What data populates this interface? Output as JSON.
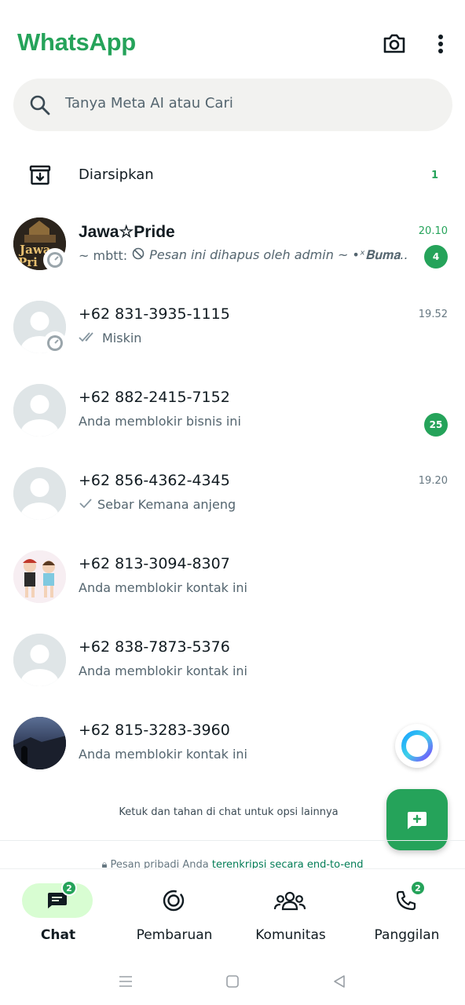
{
  "header": {
    "title": "WhatsApp",
    "camera_icon": "camera-icon",
    "menu_icon": "more-vertical-icon"
  },
  "search": {
    "placeholder": "Tanya Meta AI atau Cari",
    "icon": "search-icon"
  },
  "archived": {
    "label": "Diarsipkan",
    "count": "1",
    "icon": "archive-icon"
  },
  "chats": [
    {
      "name": "Jawa☆Pride",
      "sender": "~ mbtt:",
      "preview": "Pesan ini dihapus oleh admin ~ •ˣ𝐁𝐮𝐦𝐚...",
      "time": "20.10",
      "unread": "4",
      "avatar": "group-photo",
      "status_ring": true
    },
    {
      "name": "+62 831-3935-1115",
      "preview": "Miskin",
      "time": "19.52",
      "unread": "",
      "avatar": "default",
      "status_ring": true,
      "ticks": "double"
    },
    {
      "name": "+62 882-2415-7152",
      "preview": "Anda memblokir bisnis ini",
      "time": "",
      "unread": "25",
      "avatar": "default"
    },
    {
      "name": "+62 856-4362-4345",
      "preview": "Sebar Kemana anjeng",
      "time": "19.20",
      "unread": "",
      "avatar": "default",
      "ticks": "single"
    },
    {
      "name": "+62 813-3094-8307",
      "preview": "Anda memblokir kontak ini",
      "time": "",
      "unread": "",
      "avatar": "cartoon-photo"
    },
    {
      "name": "+62 838-7873-5376",
      "preview": "Anda memblokir kontak ini",
      "time": "",
      "unread": "",
      "avatar": "default"
    },
    {
      "name": "+62 815-3283-3960",
      "preview": "Anda memblokir kontak ini",
      "time": "",
      "unread": "",
      "avatar": "night-photo"
    }
  ],
  "hint": "Ketuk dan tahan di chat untuk opsi lainnya",
  "e2e": {
    "prefix": "Pesan pribadi Anda",
    "link": "terenkripsi secara end-to-end"
  },
  "bottom_nav": [
    {
      "label": "Chat",
      "icon": "chat-icon",
      "badge": "2",
      "active": true
    },
    {
      "label": "Pembaruan",
      "icon": "updates-icon",
      "badge": "",
      "active": false
    },
    {
      "label": "Komunitas",
      "icon": "community-icon",
      "badge": "",
      "active": false
    },
    {
      "label": "Panggilan",
      "icon": "phone-icon",
      "badge": "2",
      "active": false
    }
  ],
  "colors": {
    "brand": "#25a35a",
    "active_pill": "#d8fdd2",
    "link": "#027c56"
  }
}
